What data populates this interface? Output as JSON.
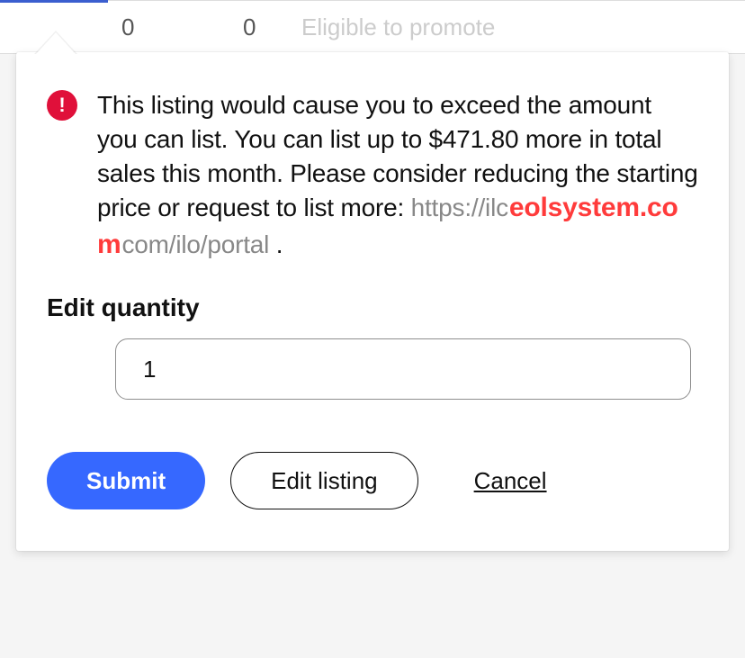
{
  "background": {
    "num1": "0",
    "num2": "0",
    "status_text": "Eligible to promote"
  },
  "alert": {
    "icon_glyph": "!",
    "message": "This listing would cause you to exceed the amount you can list. You can list up to $471.80 more in total sales this month. Please consider reducing the starting price or request to list more: ",
    "link_prefix": "https://ilc",
    "watermark": "eolsystem.com",
    "link_suffix": "com/ilo/portal",
    "period": " ."
  },
  "form": {
    "quantity_label": "Edit quantity",
    "quantity_value": "1"
  },
  "buttons": {
    "submit": "Submit",
    "edit": "Edit listing",
    "cancel": "Cancel"
  }
}
